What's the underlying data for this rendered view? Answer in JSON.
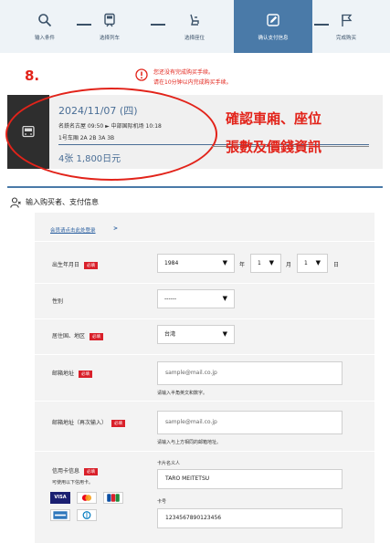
{
  "steps": [
    {
      "label": "输入条件",
      "icon": "search-icon"
    },
    {
      "label": "选择列车",
      "icon": "train-icon"
    },
    {
      "label": "选择座位",
      "icon": "seat-icon"
    },
    {
      "label": "确认支付信息",
      "icon": "edit-icon"
    },
    {
      "label": "完成购买",
      "icon": "flag-icon"
    }
  ],
  "active_step": 3,
  "annotation": {
    "number": "8.",
    "callout_line1": "確認車廂、座位",
    "callout_line2": "張數及價錢資訊"
  },
  "warning": {
    "line1": "您还没有完成购买手续。",
    "line2": "请在10分钟以内完成购买手续。"
  },
  "trip": {
    "date": "2024/11/07 (四)",
    "route": "名鉄名古屋 09:50 ► 中部国际机场 10:18",
    "seats": "1号车厢 2A 2B 3A 3B",
    "price": "4张 1,800日元"
  },
  "section": {
    "title": "输入购买者、支付信息"
  },
  "form": {
    "member_link": "会员请点击此处登录",
    "member_link_arrow": ">",
    "required_badge": "必填",
    "birth_label": "出生年月日",
    "birth_year": "1984",
    "birth_month": "1",
    "birth_day": "1",
    "unit_year": "年",
    "unit_month": "月",
    "unit_day": "日",
    "gender_label": "性别",
    "gender_value": "------",
    "region_label": "居住国、地区",
    "region_value": "台湾",
    "email_label": "邮箱地址",
    "email_placeholder": "sample@mail.co.jp",
    "email_hint": "请输入半角英文和数字。",
    "email2_label": "邮箱地址（再次输入）",
    "email2_placeholder": "sample@mail.co.jp",
    "email2_hint": "请输入与上方相同的邮箱地址。",
    "card_label": "信用卡信息",
    "card_note": "可使用以下信用卡。",
    "card_brands": [
      "VISA",
      "Mastercard",
      "JCB",
      "AMEX",
      "Diners Club"
    ],
    "holder_label": "卡片名义人",
    "holder_value": "TARO MEITETSU",
    "number_label": "卡号",
    "number_value": "1234567890123456"
  },
  "colors": {
    "accent": "#4a7aa8",
    "annotation_red": "#e2231a",
    "required_red": "#d9202a",
    "link_blue": "#2a5fa0",
    "trip_text": "#4a6e96"
  }
}
